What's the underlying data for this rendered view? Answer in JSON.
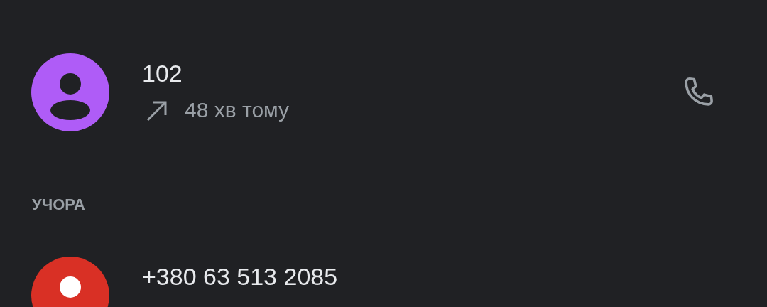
{
  "recent_calls": [
    {
      "number": "102",
      "kind": "outgoing",
      "time": "48 хв тому",
      "color": "#af5cf7",
      "call_button": true
    }
  ],
  "sections": [
    {
      "title": "УЧОРА",
      "calls": [
        {
          "number": "+380 63 513 2085",
          "color": "#d93025"
        }
      ]
    }
  ]
}
